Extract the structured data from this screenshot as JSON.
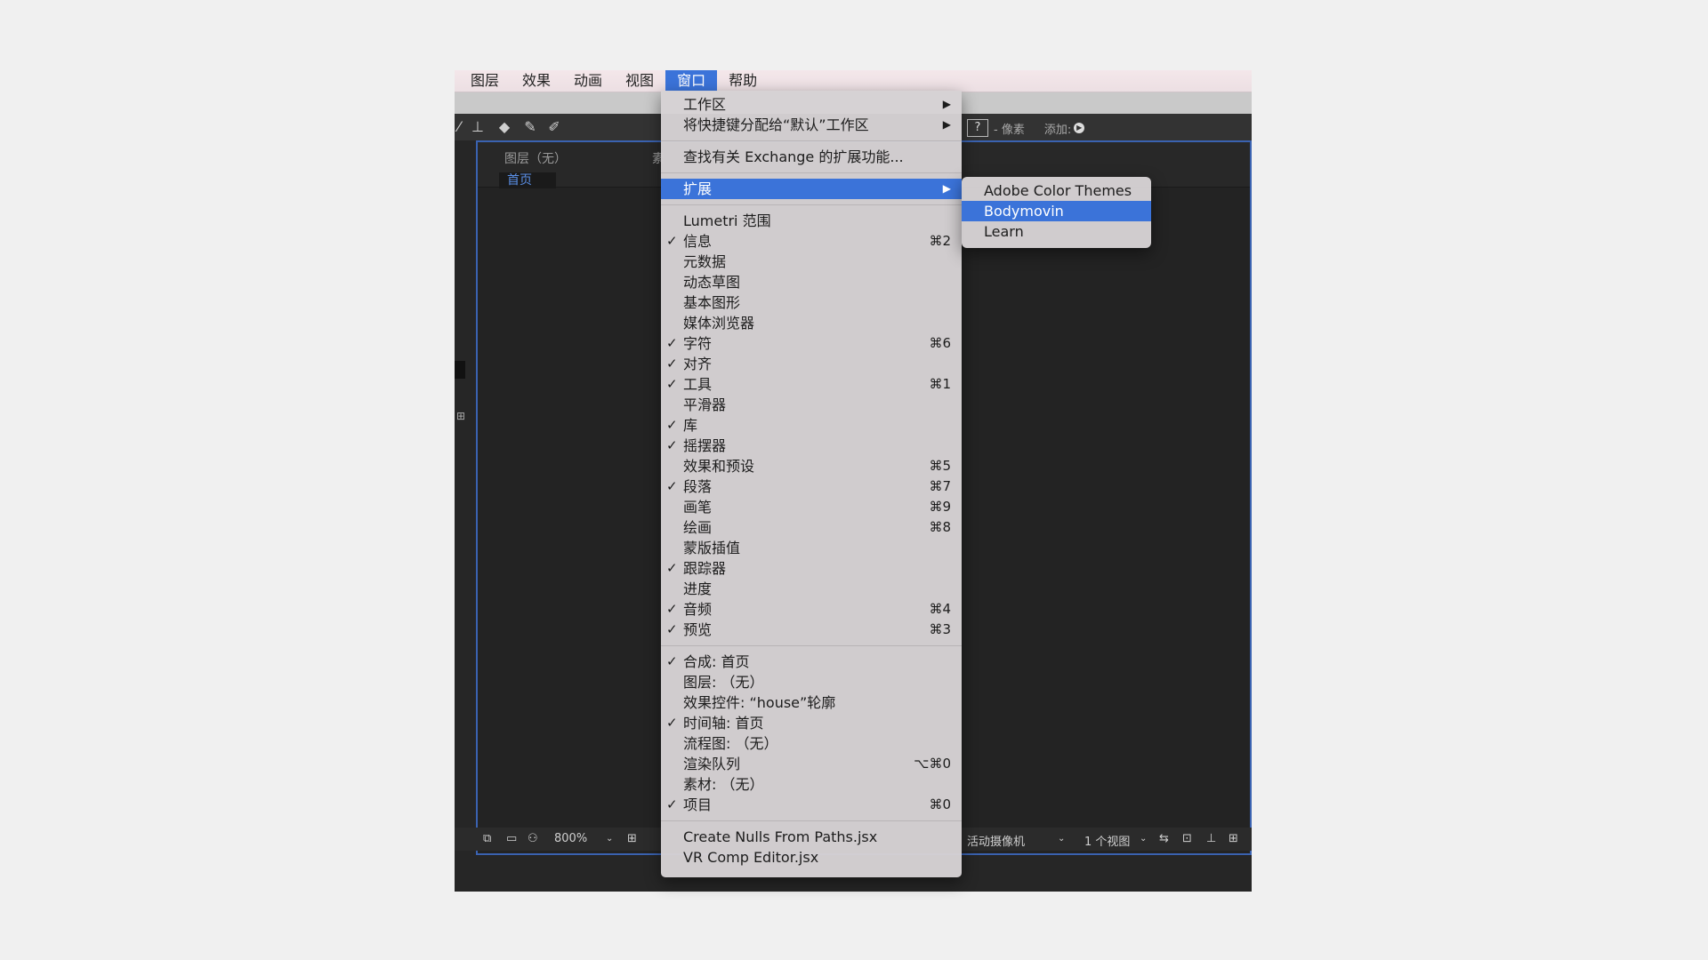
{
  "menubar": [
    {
      "label": "图层"
    },
    {
      "label": "效果"
    },
    {
      "label": "动画"
    },
    {
      "label": "视图"
    },
    {
      "label": "窗口",
      "active": true
    },
    {
      "label": "帮助"
    }
  ],
  "toolbar": {
    "right_suffix": "- 像素",
    "add_label": "添加:",
    "help_glyph": "?"
  },
  "panel": {
    "layer_tab": "图层（无）",
    "tab2_partial": "素",
    "home_tab": "首页"
  },
  "bottombar": {
    "zoom": "800%",
    "camera": "活动摄像机",
    "views": "1 个视图"
  },
  "window_menu": {
    "items": [
      {
        "label": "工作区",
        "submenu": true
      },
      {
        "label": "将快捷键分配给“默认”工作区",
        "submenu": true
      },
      {
        "sep": true
      },
      {
        "label": "查找有关 Exchange 的扩展功能..."
      },
      {
        "sep": true
      },
      {
        "label": "扩展",
        "submenu": true,
        "highlight": true
      },
      {
        "sep": true
      },
      {
        "label": "Lumetri 范围"
      },
      {
        "label": "信息",
        "check": true,
        "shortcut": "⌘2"
      },
      {
        "label": "元数据"
      },
      {
        "label": "动态草图"
      },
      {
        "label": "基本图形"
      },
      {
        "label": "媒体浏览器"
      },
      {
        "label": "字符",
        "check": true,
        "shortcut": "⌘6"
      },
      {
        "label": "对齐",
        "check": true
      },
      {
        "label": "工具",
        "check": true,
        "shortcut": "⌘1"
      },
      {
        "label": "平滑器"
      },
      {
        "label": "库",
        "check": true
      },
      {
        "label": "摇摆器",
        "check": true
      },
      {
        "label": "效果和预设",
        "shortcut": "⌘5"
      },
      {
        "label": "段落",
        "check": true,
        "shortcut": "⌘7"
      },
      {
        "label": "画笔",
        "shortcut": "⌘9"
      },
      {
        "label": "绘画",
        "shortcut": "⌘8"
      },
      {
        "label": "蒙版插值"
      },
      {
        "label": "跟踪器",
        "check": true
      },
      {
        "label": "进度"
      },
      {
        "label": "音频",
        "check": true,
        "shortcut": "⌘4"
      },
      {
        "label": "预览",
        "check": true,
        "shortcut": "⌘3"
      },
      {
        "sep": true
      },
      {
        "label": "合成: 首页",
        "check": true
      },
      {
        "label": "图层: （无）"
      },
      {
        "label": "效果控件: “house”轮廓"
      },
      {
        "label": "时间轴: 首页",
        "check": true
      },
      {
        "label": "流程图: （无）"
      },
      {
        "label": "渲染队列",
        "shortcut": "⌥⌘0"
      },
      {
        "label": "素材: （无）"
      },
      {
        "label": "项目",
        "check": true,
        "shortcut": "⌘0"
      },
      {
        "sep": true
      },
      {
        "label": "Create Nulls From Paths.jsx"
      },
      {
        "label": "VR Comp Editor.jsx"
      }
    ]
  },
  "extension_submenu": {
    "items": [
      {
        "label": "Adobe Color Themes"
      },
      {
        "label": "Bodymovin",
        "highlight": true
      },
      {
        "label": "Learn"
      }
    ]
  },
  "colors": {
    "accent": "#3b73d9",
    "menu_bg": "#d6d2d4",
    "app_bg": "#232323"
  }
}
